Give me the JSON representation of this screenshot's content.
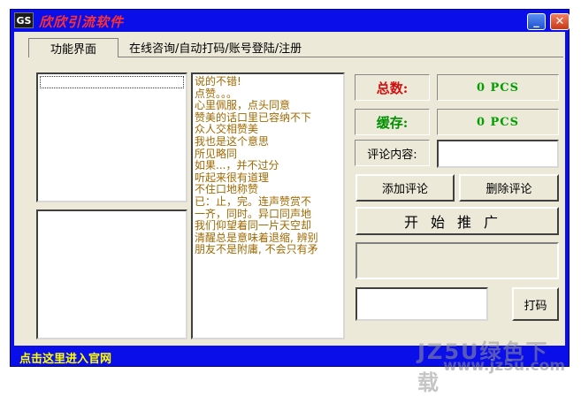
{
  "window": {
    "icon_text": "GS",
    "title": "欣欣引流软件",
    "minimize_glyph": "_",
    "close_glyph": "✕"
  },
  "tabs": [
    {
      "label": "功能界面",
      "active": true
    },
    {
      "label": "在线咨询/自动打码/账号登陆/注册",
      "active": false
    }
  ],
  "comments_text": [
    "说的不错!",
    "点赞。。。",
    "心里佩服，点头同意",
    "赞美的话口里已容纳不下",
    "众人交相赞美",
    "我也是这个意思",
    "所见略同",
    "如果...，并不过分",
    "听起来很有道理",
    "不住口地称赞",
    "已：止，完。连声赞赏不",
    "一齐，同时。异口同声地",
    "我们仰望着同一片天空却",
    "清醒总是意味着退缩, 辨别",
    "朋友不是附庸, 不会只有矛"
  ],
  "stats": {
    "total_label": "总数:",
    "total_value": "0 PCS",
    "cache_label": "缓存:",
    "cache_value": "0 PCS"
  },
  "comment": {
    "label": "评论内容:",
    "value": ""
  },
  "buttons": {
    "add": "添加评论",
    "delete": "删除评论",
    "promote": "开始推广",
    "captcha": "打码"
  },
  "captcha_input_value": "",
  "statusbar": {
    "link": "点击这里进入官网"
  },
  "watermark": {
    "line1": "JZ5U绿色下载",
    "line2": "www.jz5u.com"
  },
  "colors": {
    "window_blue": "#0a0ee8",
    "title_red": "#ff3030",
    "total_label_red": "#d01010",
    "value_green": "#00a000",
    "text_brown": "#a06800",
    "link_yellow": "#ffff00"
  }
}
